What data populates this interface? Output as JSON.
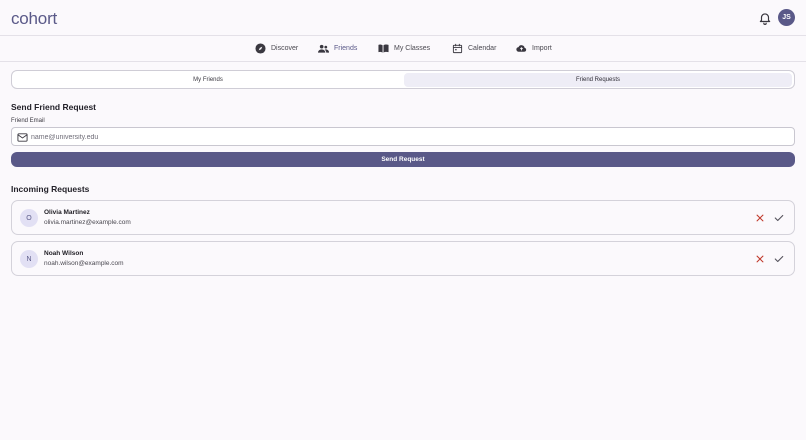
{
  "app": {
    "brand": "cohort",
    "user_initials": "JS"
  },
  "icons": {
    "bell": "bell-icon",
    "discover": "compass-icon",
    "friends": "people-icon",
    "classes": "book-icon",
    "calendar": "calendar-icon",
    "import": "cloud-upload-icon",
    "mail": "mail-icon",
    "reject": "close-icon",
    "accept": "check-icon"
  },
  "nav": {
    "discover": "Discover",
    "friends": "Friends",
    "my_classes": "My Classes",
    "calendar": "Calendar",
    "import": "Import",
    "active": "Friends"
  },
  "tabs": {
    "my_friends": "My Friends",
    "friend_requests": "Friend Requests",
    "selected": "Friend Requests"
  },
  "send": {
    "title": "Send Friend Request",
    "field_label": "Friend Email",
    "placeholder": "name@university.edu",
    "value": "",
    "button": "Send Request"
  },
  "incoming": {
    "title": "Incoming Requests",
    "requests": [
      {
        "initial": "O",
        "name": "Olivia Martinez",
        "email": "olivia.martinez@example.com"
      },
      {
        "initial": "N",
        "name": "Noah Wilson",
        "email": "noah.wilson@example.com"
      }
    ]
  },
  "colors": {
    "primary": "#5a5988",
    "reject": "#c0392b",
    "accept": "#55535c",
    "background": "#fbf9fc"
  }
}
